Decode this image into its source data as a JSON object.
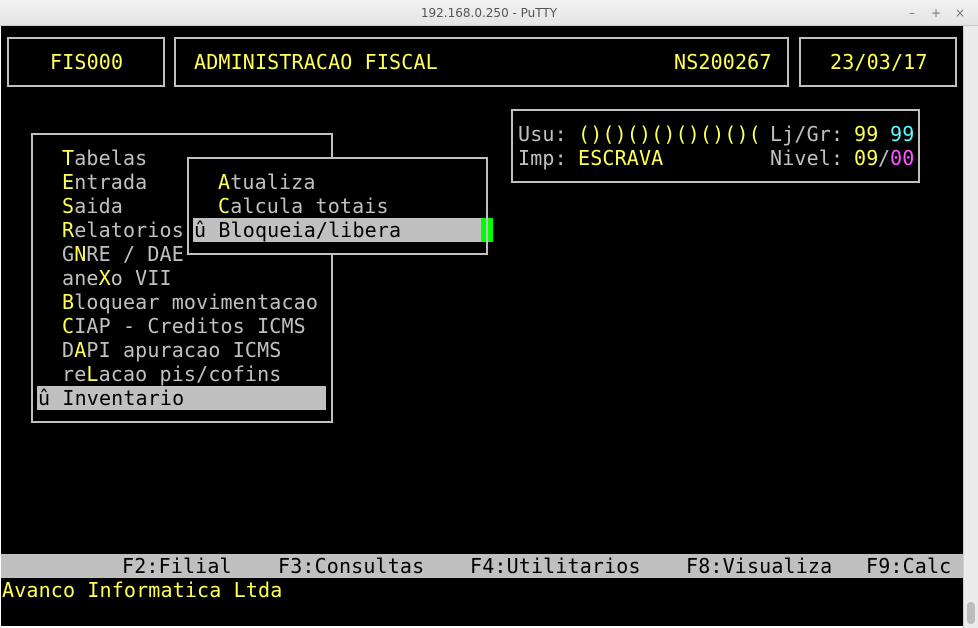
{
  "window": {
    "title": "192.168.0.250 - PuTTY",
    "minimize": "–",
    "maximize": "+",
    "close": "×"
  },
  "header": {
    "code": "FIS000",
    "title": "ADMINISTRACAO FISCAL",
    "serial": "NS200267",
    "date": "23/03/17"
  },
  "info": {
    "usu_label": "Usu:",
    "usu_value": "()()()()()()()(",
    "ljgr_label": "Lj/Gr:",
    "lj_value": "99",
    "gr_value": "99",
    "imp_label": "Imp:",
    "imp_value": "ESCRAVA",
    "nivel_label": "Nivel:",
    "nivel_a": "09",
    "nivel_sep": "/",
    "nivel_b": "00"
  },
  "menu": {
    "items": [
      {
        "hot": "T",
        "rest": "abelas"
      },
      {
        "hot": "E",
        "rest": "ntrada"
      },
      {
        "hot": "S",
        "rest": "aida"
      },
      {
        "hot": "R",
        "rest": "elatorios"
      },
      {
        "pre": "G",
        "hot": "N",
        "rest": "RE / DAE"
      },
      {
        "pre": "ane",
        "hot": "X",
        "rest": "o VII"
      },
      {
        "hot": "B",
        "rest": "loquear movimentacao"
      },
      {
        "hot": "C",
        "rest": "IAP - Creditos ICMS"
      },
      {
        "pre": "D",
        "hot": "A",
        "rest": "PI apuracao ICMS"
      },
      {
        "pre": "re",
        "hot": "L",
        "rest": "acao pis/cofins"
      },
      {
        "selected": "û Inventario"
      }
    ]
  },
  "submenu": {
    "items": [
      {
        "hot": "A",
        "rest": "tualiza"
      },
      {
        "hot": "C",
        "rest": "alcula totais"
      },
      {
        "selected": "û Bloqueia/libera"
      }
    ]
  },
  "function_bar": {
    "f2": "F2:Filial",
    "f3": "F3:Consultas",
    "f4": "F4:Utilitarios",
    "f8": "F8:Visualiza",
    "f9": "F9:Calc"
  },
  "footer": {
    "company": "Avanco Informatica Ltda"
  },
  "colors": {
    "bg": "#000000",
    "text": "#c0c0c0",
    "hot": "#ffff55",
    "cyan": "#55ffff",
    "magenta": "#ff55ff",
    "cursor": "#00ff00"
  }
}
